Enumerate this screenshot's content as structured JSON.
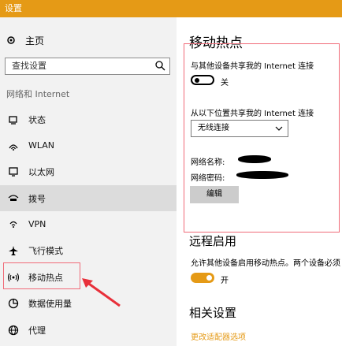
{
  "window": {
    "title": "设置"
  },
  "sidebar": {
    "home_label": "主页",
    "search_placeholder": "查找设置",
    "section_title": "网络和 Internet",
    "items": [
      {
        "label": "状态",
        "icon": "status-icon"
      },
      {
        "label": "WLAN",
        "icon": "wifi-icon"
      },
      {
        "label": "以太网",
        "icon": "ethernet-icon"
      },
      {
        "label": "拨号",
        "icon": "dialup-icon"
      },
      {
        "label": "VPN",
        "icon": "vpn-icon"
      },
      {
        "label": "飞行模式",
        "icon": "airplane-icon"
      },
      {
        "label": "移动热点",
        "icon": "hotspot-icon"
      },
      {
        "label": "数据使用量",
        "icon": "data-usage-icon"
      },
      {
        "label": "代理",
        "icon": "proxy-icon"
      }
    ]
  },
  "main": {
    "title": "移动热点",
    "share_label": "与其他设备共享我的 Internet 连接",
    "share_toggle_state": "关",
    "share_from_label": "从以下位置共享我的 Internet 连接",
    "share_from_selected": "无线连接",
    "network_name_label": "网络名称:",
    "network_password_label": "网络密码:",
    "edit_button": "编辑",
    "remote_title": "远程启用",
    "remote_desc": "允许其他设备启用移动热点。两个设备必须",
    "remote_toggle_state": "开",
    "related_title": "相关设置",
    "related_link": "更改适配器选项"
  },
  "colors": {
    "accent": "#e59a16",
    "highlight": "#f06b78"
  }
}
